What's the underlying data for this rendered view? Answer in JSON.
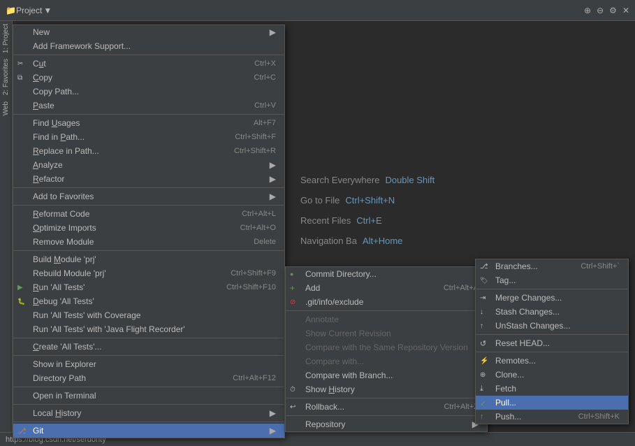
{
  "toolbar": {
    "title": "Project",
    "icons": [
      "⊕",
      "⊖",
      "⚙",
      "✕"
    ]
  },
  "sidebar_left": {
    "items": [
      {
        "label": "1: Project"
      },
      {
        "label": "2: Favorites"
      },
      {
        "label": "Web"
      }
    ]
  },
  "hint_panel": {
    "search_everywhere": {
      "label": "Search Everywhere",
      "shortcut": "Double Shift"
    },
    "go_to_file": {
      "label": "Go to File",
      "shortcut": "Ctrl+Shift+N"
    },
    "recent_files": {
      "label": "Recent Files",
      "shortcut": "Ctrl+E"
    },
    "navigation_bar": {
      "label": "Navigation Ba",
      "shortcut": "Alt+Home"
    }
  },
  "context_menu": {
    "items": [
      {
        "label": "New",
        "shortcut": "",
        "has_arrow": true,
        "type": "normal"
      },
      {
        "label": "Add Framework Support...",
        "shortcut": "",
        "has_arrow": false,
        "type": "normal"
      },
      {
        "label": "separator"
      },
      {
        "label": "Cut",
        "underline_index": 1,
        "shortcut": "Ctrl+X",
        "icon": "cut",
        "type": "normal"
      },
      {
        "label": "Copy",
        "underline_index": 0,
        "shortcut": "Ctrl+C",
        "icon": "copy",
        "type": "normal"
      },
      {
        "label": "Copy Path...",
        "shortcut": "",
        "type": "normal"
      },
      {
        "label": "Paste",
        "underline_index": 0,
        "shortcut": "Ctrl+V",
        "type": "normal"
      },
      {
        "label": "separator"
      },
      {
        "label": "Find Usages",
        "underline_index": 5,
        "shortcut": "Alt+F7",
        "type": "normal"
      },
      {
        "label": "Find in Path...",
        "underline_index": 8,
        "shortcut": "Ctrl+Shift+F",
        "type": "normal"
      },
      {
        "label": "Replace in Path...",
        "underline_index": 0,
        "shortcut": "Ctrl+Shift+R",
        "type": "normal"
      },
      {
        "label": "Analyze",
        "underline_index": 0,
        "shortcut": "",
        "has_arrow": true,
        "type": "normal"
      },
      {
        "label": "Refactor",
        "underline_index": 0,
        "shortcut": "",
        "has_arrow": true,
        "type": "normal"
      },
      {
        "label": "separator"
      },
      {
        "label": "Add to Favorites",
        "shortcut": "",
        "has_arrow": true,
        "type": "normal"
      },
      {
        "label": "separator"
      },
      {
        "label": "Reformat Code",
        "underline_index": 0,
        "shortcut": "Ctrl+Alt+L",
        "type": "normal"
      },
      {
        "label": "Optimize Imports",
        "underline_index": 0,
        "shortcut": "Ctrl+Alt+O",
        "type": "normal"
      },
      {
        "label": "Remove Module",
        "underline_index": 0,
        "shortcut": "Delete",
        "type": "normal"
      },
      {
        "label": "separator"
      },
      {
        "label": "Build Module 'prj'",
        "underline_index": 0,
        "shortcut": "",
        "type": "normal"
      },
      {
        "label": "Rebuild Module 'prj'",
        "underline_index": 0,
        "shortcut": "Ctrl+Shift+F9",
        "type": "normal"
      },
      {
        "label": "Run 'All Tests'",
        "underline_index": 0,
        "shortcut": "Ctrl+Shift+F10",
        "icon": "run",
        "type": "normal"
      },
      {
        "label": "Debug 'All Tests'",
        "underline_index": 0,
        "shortcut": "",
        "icon": "debug",
        "type": "normal"
      },
      {
        "label": "Run 'All Tests' with Coverage",
        "shortcut": "",
        "type": "normal"
      },
      {
        "label": "Run 'All Tests' with 'Java Flight Recorder'",
        "shortcut": "",
        "type": "normal"
      },
      {
        "label": "separator"
      },
      {
        "label": "Create 'All Tests'...",
        "shortcut": "",
        "type": "normal"
      },
      {
        "label": "separator"
      },
      {
        "label": "Show in Explorer",
        "shortcut": "",
        "type": "normal"
      },
      {
        "label": "Directory Path",
        "shortcut": "Ctrl+Alt+F12",
        "type": "normal"
      },
      {
        "label": "separator"
      },
      {
        "label": "Open in Terminal",
        "shortcut": "",
        "type": "normal"
      },
      {
        "label": "separator"
      },
      {
        "label": "Local History",
        "shortcut": "",
        "has_arrow": true,
        "type": "normal"
      },
      {
        "label": "separator"
      },
      {
        "label": "Git",
        "shortcut": "",
        "has_arrow": true,
        "icon": "git",
        "type": "highlighted"
      }
    ]
  },
  "submenu_git": {
    "items": [
      {
        "label": "Commit Directory...",
        "type": "normal"
      },
      {
        "label": "Add",
        "shortcut": "Ctrl+Alt+A",
        "icon": "add",
        "type": "normal"
      },
      {
        "label": ".git/info/exclude",
        "icon": "exclude",
        "type": "normal"
      },
      {
        "label": "separator"
      },
      {
        "label": "Annotate",
        "type": "disabled"
      },
      {
        "label": "Show Current Revision",
        "type": "disabled"
      },
      {
        "label": "Compare with the Same Repository Version",
        "type": "disabled"
      },
      {
        "label": "Compare with...",
        "type": "disabled"
      },
      {
        "label": "Compare with Branch...",
        "type": "normal"
      },
      {
        "label": "Show History",
        "icon": "history",
        "type": "normal"
      },
      {
        "label": "separator"
      },
      {
        "label": "Rollback...",
        "shortcut": "Ctrl+Alt+Z",
        "icon": "rollback",
        "type": "normal"
      },
      {
        "label": "separator"
      },
      {
        "label": "Repository",
        "has_arrow": true,
        "type": "normal"
      }
    ]
  },
  "submenu_repository": {
    "items": [
      {
        "label": "Branches...",
        "shortcut": "Ctrl+Shift+`",
        "icon": "branch",
        "type": "normal"
      },
      {
        "label": "Tag...",
        "icon": "tag",
        "type": "normal"
      },
      {
        "label": "separator"
      },
      {
        "label": "Merge Changes...",
        "icon": "merge",
        "type": "normal"
      },
      {
        "label": "Stash Changes...",
        "icon": "stash",
        "type": "normal"
      },
      {
        "label": "UnStash Changes...",
        "icon": "unstash",
        "type": "normal"
      },
      {
        "label": "separator"
      },
      {
        "label": "Reset HEAD...",
        "icon": "reset",
        "type": "normal"
      },
      {
        "label": "separator"
      },
      {
        "label": "Remotes...",
        "icon": "remote",
        "type": "normal"
      },
      {
        "label": "Clone...",
        "icon": "clone",
        "type": "normal"
      },
      {
        "label": "Fetch",
        "icon": "fetch",
        "type": "normal"
      },
      {
        "label": "Pull...",
        "icon": "pull-arrow",
        "type": "highlighted"
      },
      {
        "label": "Push...",
        "shortcut": "Ctrl+Shift+K",
        "icon": "push",
        "type": "normal"
      }
    ]
  },
  "bottom_bar": {
    "url": "https://blog.csdn.net/serdonty"
  }
}
